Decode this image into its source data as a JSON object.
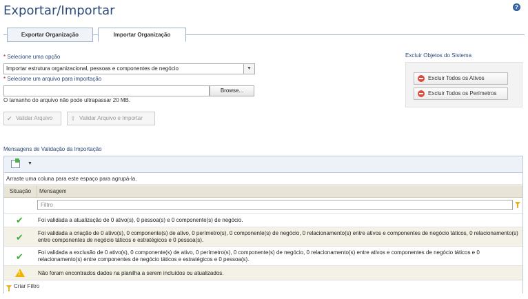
{
  "page": {
    "title": "Exportar/Importar",
    "help_icon": "?"
  },
  "tabs": [
    {
      "label": "Exportar Organização",
      "active": false
    },
    {
      "label": "Importar Organização",
      "active": true
    }
  ],
  "form": {
    "option_label": "Selecione uma opção",
    "option_value": "Importar estrutura organizacional, pessoas e componentes de negócio",
    "file_label": "Selecione um arquivo para importação",
    "file_value": "",
    "browse_label": "Browse...",
    "size_hint": "O tamanho do arquivo não pode ultrapassar 20 MB.",
    "validate_label": "Validar Arquivo",
    "validate_import_label": "Validar Arquivo e Importar"
  },
  "system": {
    "title": "Excluir Objetos do Sistema",
    "delete_assets": "Excluir Todos os Ativos",
    "delete_perimeters": "Excluir Todos os Perímetros"
  },
  "messages": {
    "title": "Mensagens de Validação da Importação",
    "group_hint": "Arraste uma coluna para este espaço para agrupá-la.",
    "col_status": "Situação",
    "col_message": "Mensagem",
    "filter_placeholder": "Filtro",
    "rows": [
      {
        "status": "success",
        "text": "Foi validada a atualização de 0 ativo(s), 0 pessoa(s) e 0 componente(s) de negócio."
      },
      {
        "status": "success",
        "text": "Foi validada a criação de 0 ativo(s), 0 componente(s) de ativo, 0 perímetro(s), 0 componente(s) de negócio, 0 relacionamento(s) entre ativos e componentes de negócio táticos, 0 relacionamento(s) entre componentes de negócio táticos e estratégicos e 0 pessoa(s)."
      },
      {
        "status": "success",
        "text": "Foi validada a exclusão de 0 ativo(s), 0 componente(s) de ativo, 0 perímetro(s), 0 componente(s) de negócio, 0 relacionamento(s) entre ativos e componentes de negócio táticos e 0 relacionamento(s) entre componentes de negócio táticos e estratégicos e 0 pessoa(s)."
      },
      {
        "status": "warning",
        "text": "Não foram encontrados dados na planilha a serem incluídos ou atualizados."
      }
    ],
    "create_filter": "Criar Filtro"
  }
}
